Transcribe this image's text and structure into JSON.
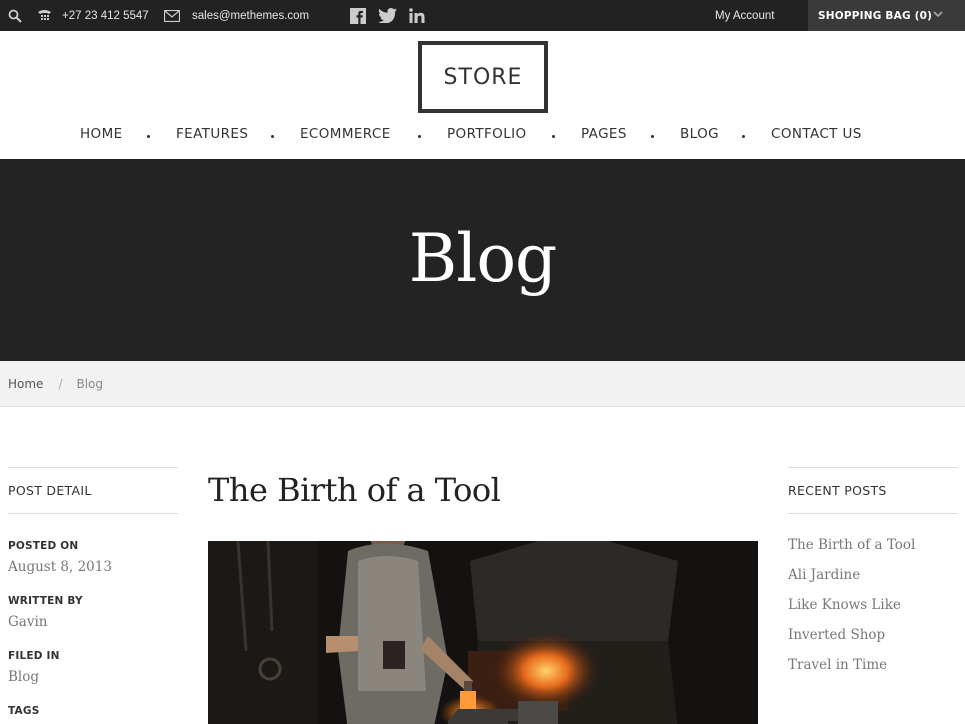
{
  "topbar": {
    "phone": "+27 23 412 5547",
    "email": "sales@methemes.com",
    "icons": [
      "search-icon",
      "phone-icon",
      "mail-icon",
      "facebook-icon",
      "twitter-icon",
      "linkedin-icon"
    ],
    "my_account": "My Account",
    "shopping_bag": "SHOPPING BAG (0)"
  },
  "header": {
    "logo": "STORE",
    "nav": [
      "HOME",
      "FEATURES",
      "ECOMMERCE",
      "PORTFOLIO",
      "PAGES",
      "BLOG",
      "CONTACT US"
    ]
  },
  "hero": {
    "title": "Blog"
  },
  "breadcrumb": {
    "home": "Home",
    "separator": "/",
    "current": "Blog"
  },
  "post_detail": {
    "heading": "POST DETAIL",
    "posted_on_label": "POSTED ON",
    "posted_on": "August 8, 2013",
    "written_by_label": "WRITTEN BY",
    "written_by": "Gavin",
    "filed_in_label": "FILED IN",
    "filed_in": "Blog",
    "tags_label": "TAGS"
  },
  "post": {
    "title": "The Birth of a Tool"
  },
  "recent_posts": {
    "heading": "RECENT POSTS",
    "items": [
      "The Birth of a Tool",
      "Ali Jardine",
      "Like Knows Like",
      "Inverted Shop",
      "Travel in Time"
    ]
  },
  "colors": {
    "topbar_bg": "#222222",
    "hero_bg": "#232323",
    "bag_bg": "#3a3a3a",
    "crumb_bg": "#f2f2f2"
  }
}
